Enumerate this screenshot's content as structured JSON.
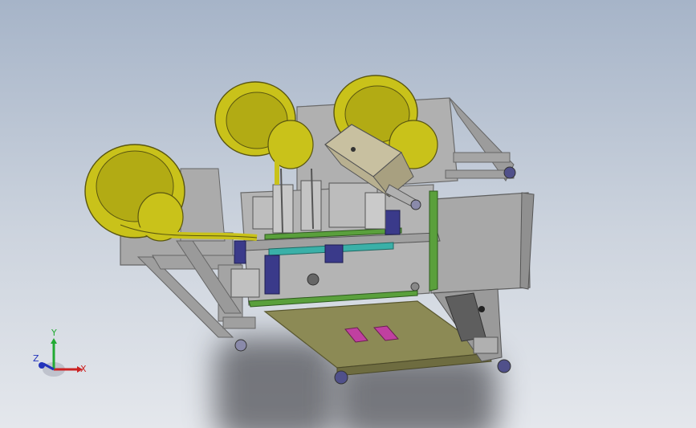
{
  "viewport": {
    "background_top": "#a6b4c8",
    "background_bottom": "#e4e7ec"
  },
  "model": {
    "colors": {
      "bowl_yellow": "#c9c21a",
      "bowl_dark": "#8b8410",
      "frame_grey": "#9a9a9a",
      "plate_grey": "#a8a8a8",
      "rail_green": "#5aa03c",
      "cylinder_blue": "#3a3a8a",
      "tray_olive": "#8c8a55",
      "marker_magenta": "#c040a0"
    }
  },
  "triad": {
    "x_label": "X",
    "y_label": "Y",
    "z_label": "Z",
    "x_color": "#cc2222",
    "y_color": "#22aa33",
    "z_color": "#2233bb"
  }
}
